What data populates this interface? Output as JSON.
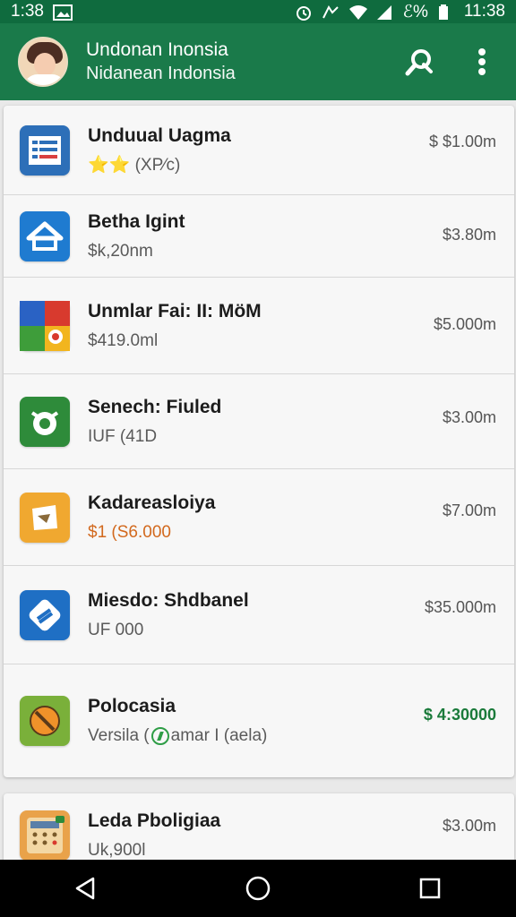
{
  "status_bar": {
    "time_left": "1:38",
    "battery_text": "ℰ%",
    "time_right": "11:38"
  },
  "app_bar": {
    "title": "Undonan Inonsia",
    "subtitle": "Nidanean Indonsia",
    "search_icon": "search-icon",
    "more_icon": "more-vert-icon",
    "accent": "#1a7a4a"
  },
  "list": [
    {
      "title": "Unduual Uagma",
      "subtitle": "⭐⭐ (XP⁄c)",
      "price": "$ $1.00m",
      "icon": "list-doc-icon"
    },
    {
      "title": "Betha Igint",
      "subtitle": "$k,20nm",
      "price": "$3.80m",
      "icon": "home-icon"
    },
    {
      "title": "Unmlar Fai: II: MöM",
      "subtitle": "$419.0ml",
      "price": "$5.000m",
      "icon": "game-tiles-icon"
    },
    {
      "title": "Senech: Fiuled",
      "subtitle": "IUF (41D",
      "price": "$3.00m",
      "icon": "shield-icon"
    },
    {
      "title": "Kadareasloiya",
      "subtitle": "$1 (S6.000",
      "price": "$7.00m",
      "icon": "paper-icon"
    },
    {
      "title": "Miesdo: Shdbanel",
      "subtitle": "UF 000",
      "price": "$35.000m",
      "icon": "link-icon"
    },
    {
      "title": "Polocasia",
      "subtitle_before": "Versila (",
      "subtitle_after": "amar I (aela)",
      "price": "$ 4:30000",
      "icon": "no-sign-icon"
    }
  ],
  "second_card": [
    {
      "title": "Leda Pboligiaa",
      "subtitle": "Uk,900l",
      "price": "$3.00m",
      "icon": "calculator-icon"
    }
  ],
  "nav_bar": {
    "back": "back-icon",
    "home": "home-circle-icon",
    "recents": "recents-icon"
  }
}
